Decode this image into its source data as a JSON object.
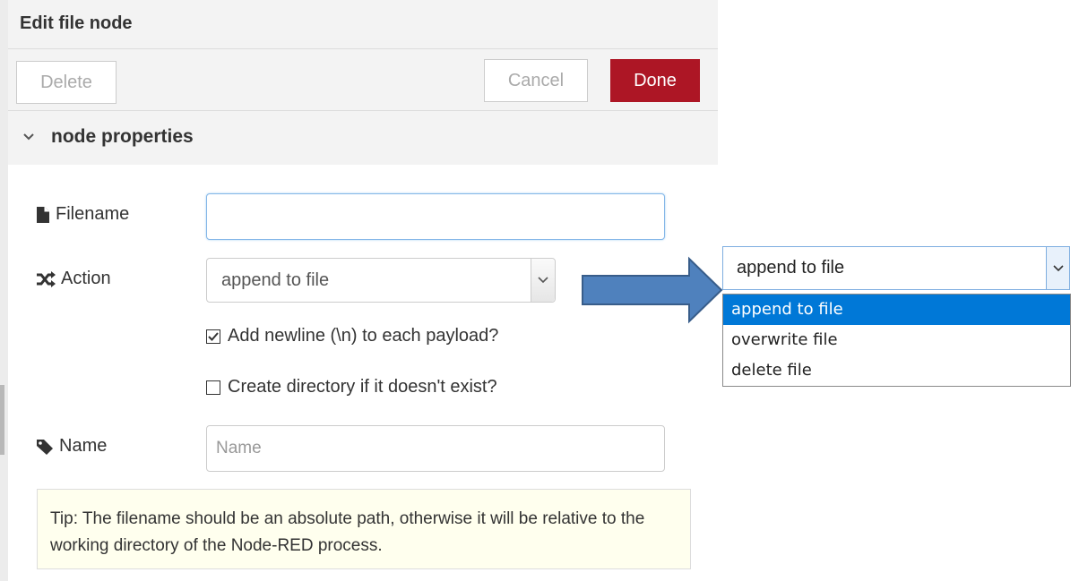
{
  "tray": {
    "title": "Edit file node",
    "buttons": {
      "delete": "Delete",
      "cancel": "Cancel",
      "done": "Done"
    },
    "section_title": "node properties"
  },
  "form": {
    "filename": {
      "label": "Filename",
      "value": "",
      "icon": "file-icon"
    },
    "action": {
      "label": "Action",
      "selected": "append to file",
      "icon": "shuffle-icon"
    },
    "newline_checkbox": {
      "label": "Add newline (\\n) to each payload?",
      "checked": true
    },
    "createdir_checkbox": {
      "label": "Create directory if it doesn't exist?",
      "checked": false
    },
    "name": {
      "label": "Name",
      "placeholder": "Name",
      "icon": "tag-icon"
    },
    "tip": "Tip: The filename should be an absolute path, otherwise it will be relative to the working directory of the Node-RED process."
  },
  "dropdown": {
    "selected": "append to file",
    "options": [
      "append to file",
      "overwrite file",
      "delete file"
    ],
    "highlighted_index": 0
  },
  "colors": {
    "done_button": "#ad1625",
    "arrow_fill": "#4f81bd",
    "arrow_stroke": "#385d8a",
    "dropdown_highlight": "#0078d7",
    "tip_background": "#ffffee"
  }
}
